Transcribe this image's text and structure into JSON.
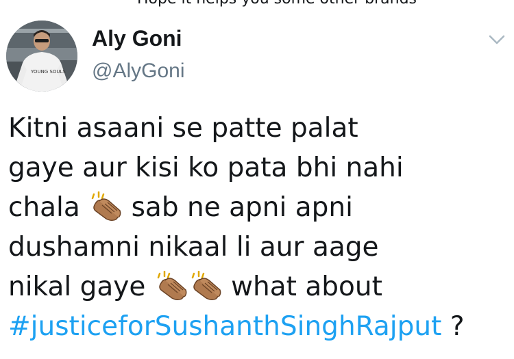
{
  "cut_off_line": "Hope it helps you some other brands",
  "author": {
    "display_name": "Aly Goni",
    "handle": "@AlyGoni",
    "avatar_shirt_text": "YOUNG SOULS"
  },
  "menu": {
    "icon": "chevron-down-icon"
  },
  "tweet": {
    "line1": "Kitni asaani se patte palat",
    "line2": "gaye aur kisi ko pata bhi nahi",
    "line3_before": "chala",
    "line3_after": "sab ne apni apni",
    "line4": "dushamni nikaal li aur aage",
    "line5_before": "nikal gaye",
    "line5_after": "what about",
    "hashtag": "#justiceforSushanthSinghRajput",
    "line6_after": "?"
  },
  "colors": {
    "text": "#14171a",
    "handle": "#657786",
    "link": "#1da1f2",
    "clap_skin": "#b07a4f"
  }
}
